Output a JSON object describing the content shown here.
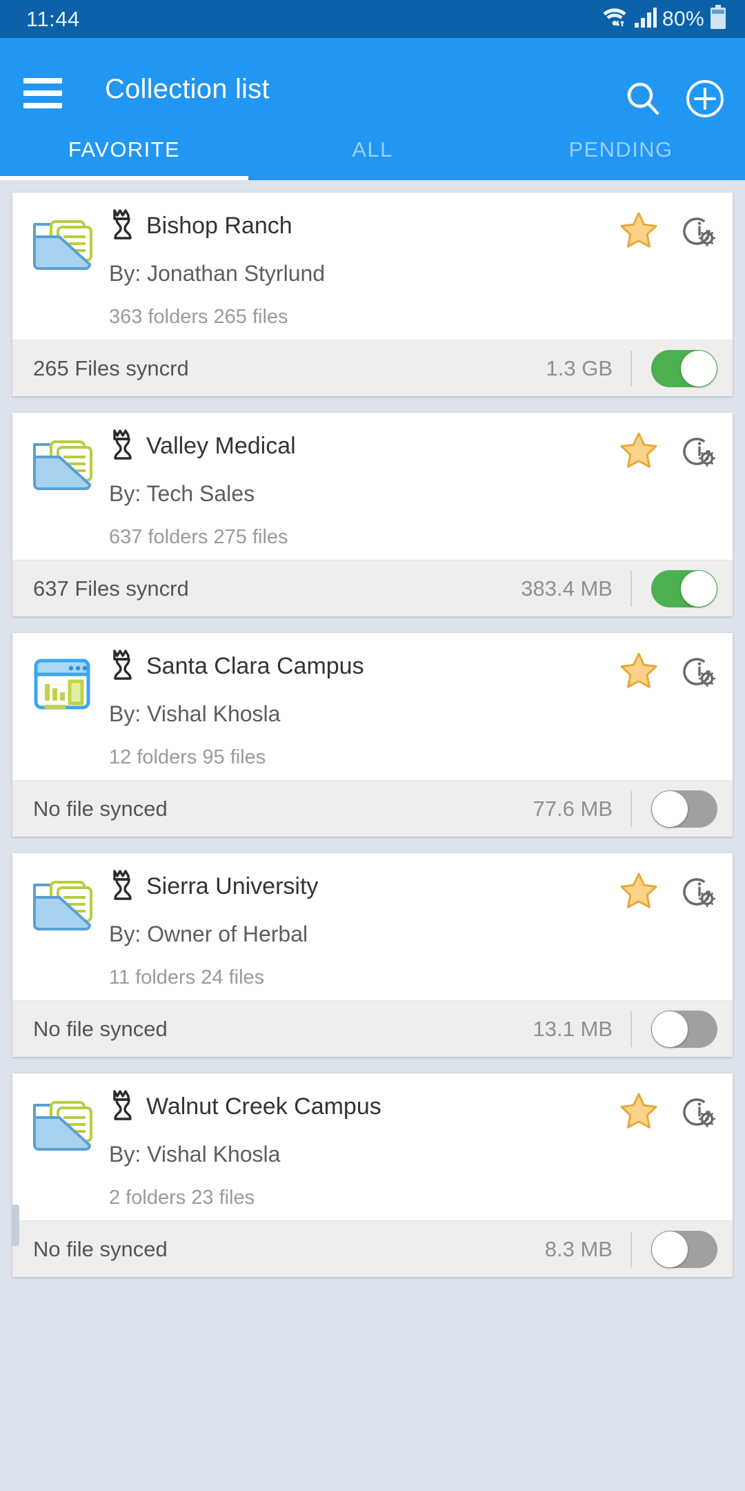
{
  "status_bar": {
    "time": "11:44",
    "battery_percent": "80%",
    "icons": [
      "wifi-icon",
      "signal-icon",
      "battery-icon"
    ],
    "background_color": "#0b62a8"
  },
  "app_bar": {
    "title": "Collection list",
    "menu_icon": "hamburger-icon",
    "search_icon": "search-icon",
    "add_icon": "plus-circle-icon",
    "background_color": "#2196f3"
  },
  "tabs": [
    {
      "label": "FAVORITE",
      "active": true
    },
    {
      "label": "ALL",
      "active": false
    },
    {
      "label": "PENDING",
      "active": false
    }
  ],
  "colors": {
    "accent": "#2196f3",
    "status_bar": "#0b62a8",
    "page_background": "#dde3ec",
    "star": "#f5b942",
    "toggle_on": "#4cb050",
    "toggle_off": "#a0a0a0"
  },
  "collections": [
    {
      "thumb_icon": "folder-documents-icon",
      "type_icon": "chess-queen-icon",
      "title": "Bishop Ranch",
      "owner": "By:  Jonathan Styrlund",
      "counts": "363 folders 265 files",
      "favorite": true,
      "star_icon": "star-icon",
      "info_icon": "info-gear-icon",
      "sync_status": "265 Files syncrd",
      "size": "1.3 GB",
      "sync_enabled": true
    },
    {
      "thumb_icon": "folder-documents-icon",
      "type_icon": "chess-queen-icon",
      "title": "Valley Medical",
      "owner": "By: Tech Sales",
      "counts": "637 folders 275 files",
      "favorite": true,
      "star_icon": "star-icon",
      "info_icon": "info-gear-icon",
      "sync_status": "637 Files syncrd",
      "size": "383.4 MB",
      "sync_enabled": true
    },
    {
      "thumb_icon": "browser-chart-icon",
      "type_icon": "chess-queen-icon",
      "title": "Santa Clara Campus",
      "owner": "By: Vishal Khosla",
      "counts": "12 folders 95 files",
      "favorite": true,
      "star_icon": "star-icon",
      "info_icon": "info-gear-icon",
      "sync_status": "No file synced",
      "size": "77.6 MB",
      "sync_enabled": false
    },
    {
      "thumb_icon": "folder-documents-icon",
      "type_icon": "chess-queen-icon",
      "title": "Sierra University",
      "owner": "By: Owner of Herbal",
      "counts": "11 folders 24 files",
      "favorite": true,
      "star_icon": "star-icon",
      "info_icon": "info-gear-icon",
      "sync_status": "No file synced",
      "size": "13.1 MB",
      "sync_enabled": false
    },
    {
      "thumb_icon": "folder-documents-icon",
      "type_icon": "chess-queen-icon",
      "title": "Walnut Creek Campus",
      "owner": "By: Vishal Khosla",
      "counts": "2 folders 23 files",
      "favorite": true,
      "star_icon": "star-icon",
      "info_icon": "info-gear-icon",
      "sync_status": "No file synced",
      "size": "8.3 MB",
      "sync_enabled": false
    }
  ]
}
